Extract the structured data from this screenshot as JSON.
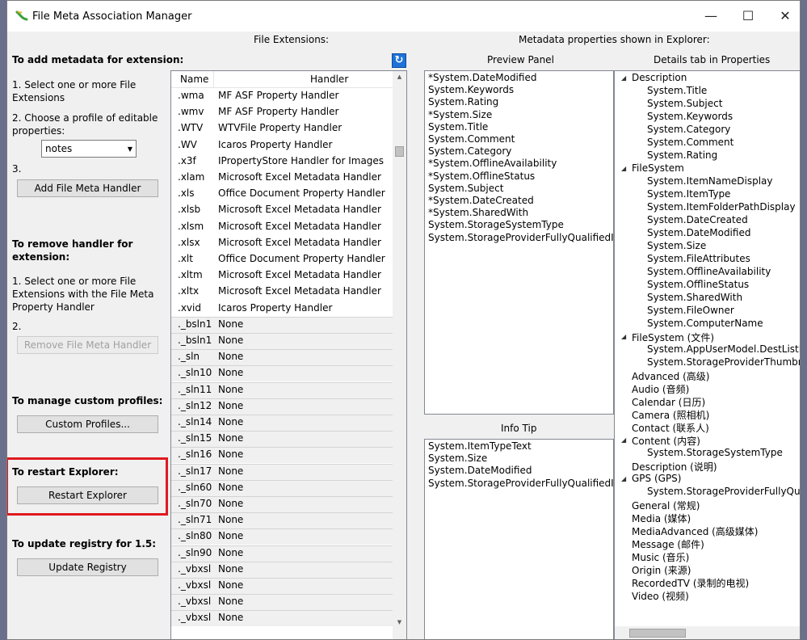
{
  "window": {
    "title": "File Meta Association Manager",
    "minimize": "—",
    "maximize": "☐",
    "close": "✕"
  },
  "left": {
    "add_title": "To add metadata for extension:",
    "add_step1": "1. Select one or more File Extensions",
    "add_step2": "2. Choose a profile of editable properties:",
    "profile_value": "notes",
    "add_step3": "3.",
    "add_button": "Add File Meta Handler",
    "remove_title": "To remove handler for extension:",
    "remove_step1": "1. Select one or more File Extensions with the File Meta Property Handler",
    "remove_step2": "2.",
    "remove_button": "Remove File Meta Handler",
    "profiles_title": "To manage custom profiles:",
    "profiles_button": "Custom Profiles...",
    "restart_title": "To restart Explorer:",
    "restart_button": "Restart Explorer",
    "update_title": "To update registry for 1.5:",
    "update_button": "Update Registry"
  },
  "extensions": {
    "heading": "File Extensions:",
    "col_name": "Name",
    "col_handler": "Handler",
    "rows": [
      {
        "name": ".wma",
        "handler": "MF ASF Property Handler"
      },
      {
        "name": ".wmv",
        "handler": "MF ASF Property Handler"
      },
      {
        "name": ".WTV",
        "handler": "WTVFile Property Handler"
      },
      {
        "name": ".WV",
        "handler": "Icaros Property Handler"
      },
      {
        "name": ".x3f",
        "handler": "IPropertyStore Handler for Images"
      },
      {
        "name": ".xlam",
        "handler": "Microsoft Excel Metadata Handler"
      },
      {
        "name": ".xls",
        "handler": "Office Document Property Handler"
      },
      {
        "name": ".xlsb",
        "handler": "Microsoft Excel Metadata Handler"
      },
      {
        "name": ".xlsm",
        "handler": "Microsoft Excel Metadata Handler"
      },
      {
        "name": ".xlsx",
        "handler": "Microsoft Excel Metadata Handler"
      },
      {
        "name": ".xlt",
        "handler": "Office Document Property Handler"
      },
      {
        "name": ".xltm",
        "handler": "Microsoft Excel Metadata Handler"
      },
      {
        "name": ".xltx",
        "handler": "Microsoft Excel Metadata Handler"
      },
      {
        "name": ".xvid",
        "handler": "Icaros Property Handler"
      },
      {
        "name": "._bsln1",
        "handler": "None"
      },
      {
        "name": "._bsln1",
        "handler": "None"
      },
      {
        "name": "._sln",
        "handler": "None"
      },
      {
        "name": "._sln10",
        "handler": "None"
      },
      {
        "name": "._sln11",
        "handler": "None"
      },
      {
        "name": "._sln12",
        "handler": "None"
      },
      {
        "name": "._sln14",
        "handler": "None"
      },
      {
        "name": "._sln15",
        "handler": "None"
      },
      {
        "name": "._sln16",
        "handler": "None"
      },
      {
        "name": "._sln17",
        "handler": "None"
      },
      {
        "name": "._sln60",
        "handler": "None"
      },
      {
        "name": "._sln70",
        "handler": "None"
      },
      {
        "name": "._sln71",
        "handler": "None"
      },
      {
        "name": "._sln80",
        "handler": "None"
      },
      {
        "name": "._sln90",
        "handler": "None"
      },
      {
        "name": "._vbxsl",
        "handler": "None"
      },
      {
        "name": "._vbxsl",
        "handler": "None"
      },
      {
        "name": "._vbxsl",
        "handler": "None"
      },
      {
        "name": "._vbxsl",
        "handler": "None"
      }
    ]
  },
  "metadata": {
    "heading": "Metadata properties shown in Explorer:",
    "preview_heading": "Preview Panel",
    "preview_items": [
      "*System.DateModified",
      "System.Keywords",
      "System.Rating",
      "*System.Size",
      "System.Title",
      "System.Comment",
      "System.Category",
      "*System.OfflineAvailability",
      "*System.OfflineStatus",
      "System.Subject",
      "*System.DateCreated",
      "*System.SharedWith",
      "System.StorageSystemType",
      "System.StorageProviderFullyQualifiedId"
    ],
    "infotip_heading": "Info Tip",
    "infotip_items": [
      "System.ItemTypeText",
      "System.Size",
      "System.DateModified",
      "System.StorageProviderFullyQualifiedId"
    ],
    "details_heading": "Details tab in Properties",
    "details_tree": [
      {
        "label": "Description",
        "expanded": true,
        "children": [
          "System.Title",
          "System.Subject",
          "System.Keywords",
          "System.Category",
          "System.Comment",
          "System.Rating"
        ]
      },
      {
        "label": "FileSystem",
        "expanded": true,
        "children": [
          "System.ItemNameDisplay",
          "System.ItemType",
          "System.ItemFolderPathDisplay",
          "System.DateCreated",
          "System.DateModified",
          "System.Size",
          "System.FileAttributes",
          "System.OfflineAvailability",
          "System.OfflineStatus",
          "System.SharedWith",
          "System.FileOwner",
          "System.ComputerName"
        ]
      },
      {
        "label": "FileSystem (文件)",
        "expanded": true,
        "children": [
          "System.AppUserModel.DestListLo",
          "System.StorageProviderThumbna"
        ]
      },
      {
        "label": "Advanced (高级)",
        "expanded": false,
        "children": []
      },
      {
        "label": "Audio (音频)",
        "expanded": false,
        "children": []
      },
      {
        "label": "Calendar (日历)",
        "expanded": false,
        "children": []
      },
      {
        "label": "Camera (照相机)",
        "expanded": false,
        "children": []
      },
      {
        "label": "Contact (联系人)",
        "expanded": false,
        "children": []
      },
      {
        "label": "Content (内容)",
        "expanded": true,
        "children": [
          "System.StorageSystemType"
        ]
      },
      {
        "label": "Description (说明)",
        "expanded": false,
        "children": []
      },
      {
        "label": "GPS (GPS)",
        "expanded": true,
        "children": [
          "System.StorageProviderFullyQual"
        ]
      },
      {
        "label": "General (常规)",
        "expanded": false,
        "children": []
      },
      {
        "label": "Media (媒体)",
        "expanded": false,
        "children": []
      },
      {
        "label": "MediaAdvanced (高级媒体)",
        "expanded": false,
        "children": []
      },
      {
        "label": "Message (邮件)",
        "expanded": false,
        "children": []
      },
      {
        "label": "Music (音乐)",
        "expanded": false,
        "children": []
      },
      {
        "label": "Origin (来源)",
        "expanded": false,
        "children": []
      },
      {
        "label": "RecordedTV (录制的电视)",
        "expanded": false,
        "children": []
      },
      {
        "label": "Video (视频)",
        "expanded": false,
        "children": []
      }
    ]
  },
  "colors": {
    "highlight_box": "#e0191f",
    "refresh_button": "#1e73d8"
  }
}
